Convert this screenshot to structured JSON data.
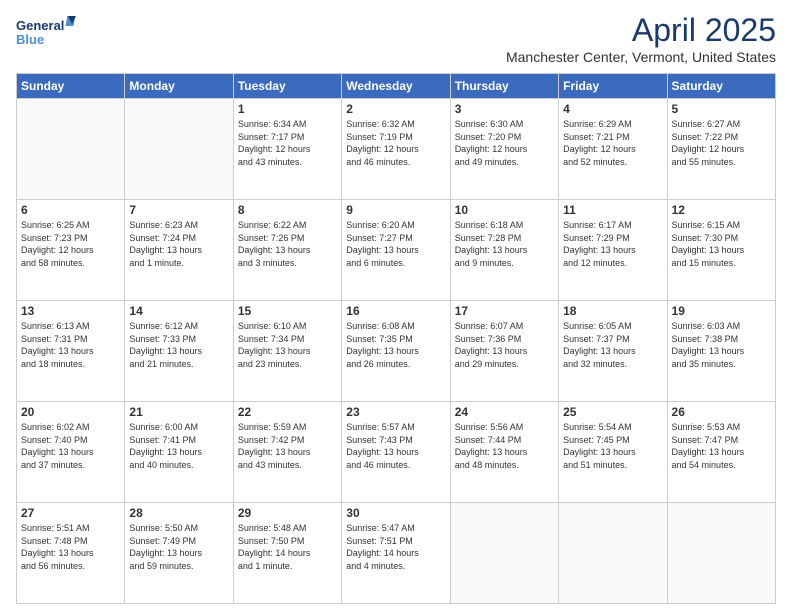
{
  "logo": {
    "line1": "General",
    "line2": "Blue"
  },
  "title": "April 2025",
  "location": "Manchester Center, Vermont, United States",
  "weekdays": [
    "Sunday",
    "Monday",
    "Tuesday",
    "Wednesday",
    "Thursday",
    "Friday",
    "Saturday"
  ],
  "weeks": [
    [
      {
        "day": "",
        "info": "",
        "empty": true
      },
      {
        "day": "",
        "info": "",
        "empty": true
      },
      {
        "day": "1",
        "info": "Sunrise: 6:34 AM\nSunset: 7:17 PM\nDaylight: 12 hours\nand 43 minutes."
      },
      {
        "day": "2",
        "info": "Sunrise: 6:32 AM\nSunset: 7:19 PM\nDaylight: 12 hours\nand 46 minutes."
      },
      {
        "day": "3",
        "info": "Sunrise: 6:30 AM\nSunset: 7:20 PM\nDaylight: 12 hours\nand 49 minutes."
      },
      {
        "day": "4",
        "info": "Sunrise: 6:29 AM\nSunset: 7:21 PM\nDaylight: 12 hours\nand 52 minutes."
      },
      {
        "day": "5",
        "info": "Sunrise: 6:27 AM\nSunset: 7:22 PM\nDaylight: 12 hours\nand 55 minutes."
      }
    ],
    [
      {
        "day": "6",
        "info": "Sunrise: 6:25 AM\nSunset: 7:23 PM\nDaylight: 12 hours\nand 58 minutes."
      },
      {
        "day": "7",
        "info": "Sunrise: 6:23 AM\nSunset: 7:24 PM\nDaylight: 13 hours\nand 1 minute."
      },
      {
        "day": "8",
        "info": "Sunrise: 6:22 AM\nSunset: 7:26 PM\nDaylight: 13 hours\nand 3 minutes."
      },
      {
        "day": "9",
        "info": "Sunrise: 6:20 AM\nSunset: 7:27 PM\nDaylight: 13 hours\nand 6 minutes."
      },
      {
        "day": "10",
        "info": "Sunrise: 6:18 AM\nSunset: 7:28 PM\nDaylight: 13 hours\nand 9 minutes."
      },
      {
        "day": "11",
        "info": "Sunrise: 6:17 AM\nSunset: 7:29 PM\nDaylight: 13 hours\nand 12 minutes."
      },
      {
        "day": "12",
        "info": "Sunrise: 6:15 AM\nSunset: 7:30 PM\nDaylight: 13 hours\nand 15 minutes."
      }
    ],
    [
      {
        "day": "13",
        "info": "Sunrise: 6:13 AM\nSunset: 7:31 PM\nDaylight: 13 hours\nand 18 minutes."
      },
      {
        "day": "14",
        "info": "Sunrise: 6:12 AM\nSunset: 7:33 PM\nDaylight: 13 hours\nand 21 minutes."
      },
      {
        "day": "15",
        "info": "Sunrise: 6:10 AM\nSunset: 7:34 PM\nDaylight: 13 hours\nand 23 minutes."
      },
      {
        "day": "16",
        "info": "Sunrise: 6:08 AM\nSunset: 7:35 PM\nDaylight: 13 hours\nand 26 minutes."
      },
      {
        "day": "17",
        "info": "Sunrise: 6:07 AM\nSunset: 7:36 PM\nDaylight: 13 hours\nand 29 minutes."
      },
      {
        "day": "18",
        "info": "Sunrise: 6:05 AM\nSunset: 7:37 PM\nDaylight: 13 hours\nand 32 minutes."
      },
      {
        "day": "19",
        "info": "Sunrise: 6:03 AM\nSunset: 7:38 PM\nDaylight: 13 hours\nand 35 minutes."
      }
    ],
    [
      {
        "day": "20",
        "info": "Sunrise: 6:02 AM\nSunset: 7:40 PM\nDaylight: 13 hours\nand 37 minutes."
      },
      {
        "day": "21",
        "info": "Sunrise: 6:00 AM\nSunset: 7:41 PM\nDaylight: 13 hours\nand 40 minutes."
      },
      {
        "day": "22",
        "info": "Sunrise: 5:59 AM\nSunset: 7:42 PM\nDaylight: 13 hours\nand 43 minutes."
      },
      {
        "day": "23",
        "info": "Sunrise: 5:57 AM\nSunset: 7:43 PM\nDaylight: 13 hours\nand 46 minutes."
      },
      {
        "day": "24",
        "info": "Sunrise: 5:56 AM\nSunset: 7:44 PM\nDaylight: 13 hours\nand 48 minutes."
      },
      {
        "day": "25",
        "info": "Sunrise: 5:54 AM\nSunset: 7:45 PM\nDaylight: 13 hours\nand 51 minutes."
      },
      {
        "day": "26",
        "info": "Sunrise: 5:53 AM\nSunset: 7:47 PM\nDaylight: 13 hours\nand 54 minutes."
      }
    ],
    [
      {
        "day": "27",
        "info": "Sunrise: 5:51 AM\nSunset: 7:48 PM\nDaylight: 13 hours\nand 56 minutes."
      },
      {
        "day": "28",
        "info": "Sunrise: 5:50 AM\nSunset: 7:49 PM\nDaylight: 13 hours\nand 59 minutes."
      },
      {
        "day": "29",
        "info": "Sunrise: 5:48 AM\nSunset: 7:50 PM\nDaylight: 14 hours\nand 1 minute."
      },
      {
        "day": "30",
        "info": "Sunrise: 5:47 AM\nSunset: 7:51 PM\nDaylight: 14 hours\nand 4 minutes."
      },
      {
        "day": "",
        "info": "",
        "empty": true
      },
      {
        "day": "",
        "info": "",
        "empty": true
      },
      {
        "day": "",
        "info": "",
        "empty": true
      }
    ]
  ]
}
